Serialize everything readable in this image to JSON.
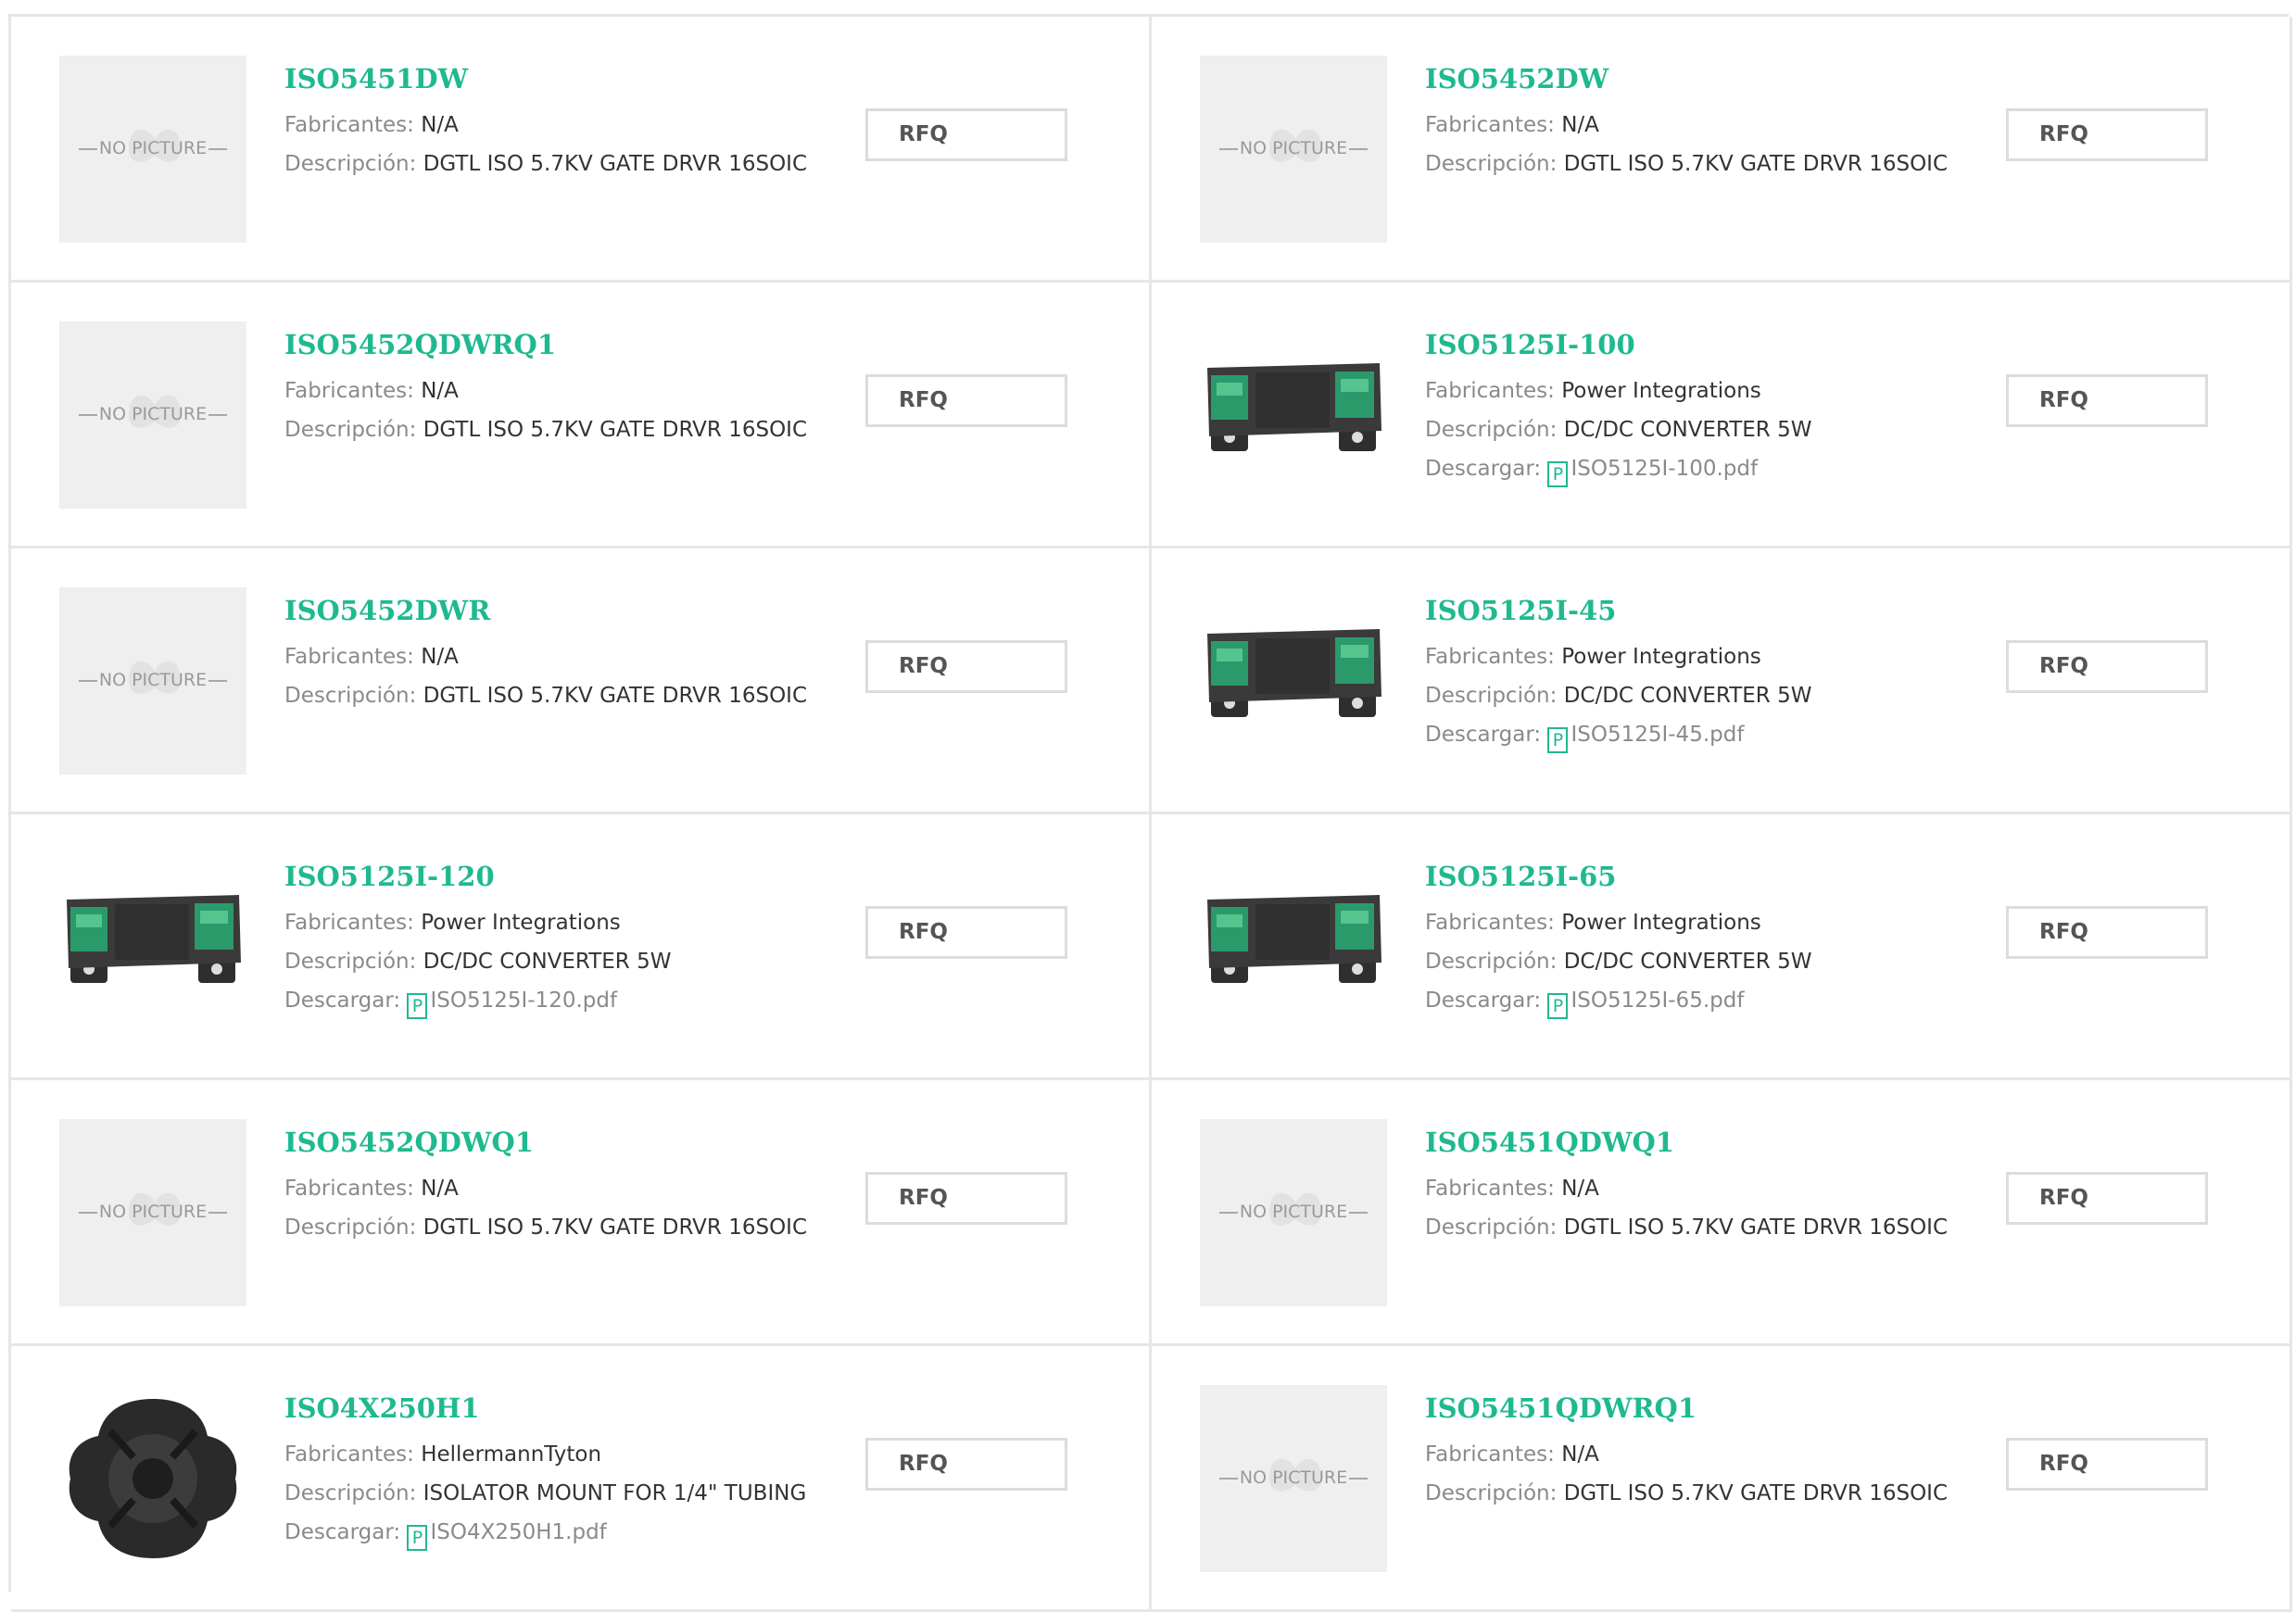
{
  "labels": {
    "manufacturer": "Fabricantes:",
    "description": "Descripción:",
    "download": "Descargar:",
    "rfq": "RFQ",
    "no_picture": "NO PICTURE",
    "pdf_glyph": "P"
  },
  "products": [
    {
      "name": "ISO5451DW",
      "manufacturer": "N/A",
      "description": "DGTL ISO 5.7KV GATE DRVR 16SOIC",
      "image": "no-picture",
      "pdf": ""
    },
    {
      "name": "ISO5452DW",
      "manufacturer": "N/A",
      "description": "DGTL ISO 5.7KV GATE DRVR 16SOIC",
      "image": "no-picture",
      "pdf": ""
    },
    {
      "name": "ISO5452QDWRQ1",
      "manufacturer": "N/A",
      "description": "DGTL ISO 5.7KV GATE DRVR 16SOIC",
      "image": "no-picture",
      "pdf": ""
    },
    {
      "name": "ISO5125I-100",
      "manufacturer": "Power Integrations",
      "description": "DC/DC CONVERTER 5W",
      "image": "converter-photo",
      "pdf": "ISO5125I-100.pdf"
    },
    {
      "name": "ISO5452DWR",
      "manufacturer": "N/A",
      "description": "DGTL ISO 5.7KV GATE DRVR 16SOIC",
      "image": "no-picture",
      "pdf": ""
    },
    {
      "name": "ISO5125I-45",
      "manufacturer": "Power Integrations",
      "description": "DC/DC CONVERTER 5W",
      "image": "converter-photo",
      "pdf": "ISO5125I-45.pdf"
    },
    {
      "name": "ISO5125I-120",
      "manufacturer": "Power Integrations",
      "description": "DC/DC CONVERTER 5W",
      "image": "converter-photo",
      "pdf": "ISO5125I-120.pdf"
    },
    {
      "name": "ISO5125I-65",
      "manufacturer": "Power Integrations",
      "description": "DC/DC CONVERTER 5W",
      "image": "converter-photo",
      "pdf": "ISO5125I-65.pdf"
    },
    {
      "name": "ISO5452QDWQ1",
      "manufacturer": "N/A",
      "description": "DGTL ISO 5.7KV GATE DRVR 16SOIC",
      "image": "no-picture",
      "pdf": ""
    },
    {
      "name": "ISO5451QDWQ1",
      "manufacturer": "N/A",
      "description": "DGTL ISO 5.7KV GATE DRVR 16SOIC",
      "image": "no-picture",
      "pdf": ""
    },
    {
      "name": "ISO4X250H1",
      "manufacturer": "HellermannTyton",
      "description": "ISOLATOR MOUNT FOR 1/4\" TUBING",
      "image": "isolator-mount-photo",
      "pdf": "ISO4X250H1.pdf"
    },
    {
      "name": "ISO5451QDWRQ1",
      "manufacturer": "N/A",
      "description": "DGTL ISO 5.7KV GATE DRVR 16SOIC",
      "image": "no-picture",
      "pdf": ""
    }
  ]
}
